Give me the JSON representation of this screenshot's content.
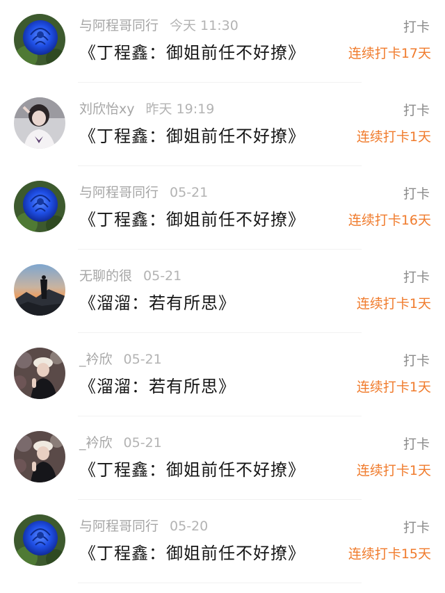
{
  "action_label": "打卡",
  "items": [
    {
      "user": "与阿程哥同行",
      "time": "今天 11:30",
      "title": "《丁程鑫：御姐前任不好撩》",
      "streak": "连续打卡17天",
      "avatar": "blue-rose"
    },
    {
      "user": "刘欣怡xy",
      "time": "昨天 19:19",
      "title": "《丁程鑫：御姐前任不好撩》",
      "streak": "连续打卡1天",
      "avatar": "girl-butterfly"
    },
    {
      "user": "与阿程哥同行",
      "time": "05-21",
      "title": "《丁程鑫：御姐前任不好撩》",
      "streak": "连续打卡16天",
      "avatar": "blue-rose"
    },
    {
      "user": "无聊的很",
      "time": "05-21",
      "title": "《溜溜：若有所思》",
      "streak": "连续打卡1天",
      "avatar": "mountain-dusk"
    },
    {
      "user": "_衿欣",
      "time": "05-21",
      "title": "《溜溜：若有所思》",
      "streak": "连续打卡1天",
      "avatar": "girl-cap"
    },
    {
      "user": "_衿欣",
      "time": "05-21",
      "title": "《丁程鑫：御姐前任不好撩》",
      "streak": "连续打卡1天",
      "avatar": "girl-cap"
    },
    {
      "user": "与阿程哥同行",
      "time": "05-20",
      "title": "《丁程鑫：御姐前任不好撩》",
      "streak": "连续打卡15天",
      "avatar": "blue-rose"
    }
  ]
}
